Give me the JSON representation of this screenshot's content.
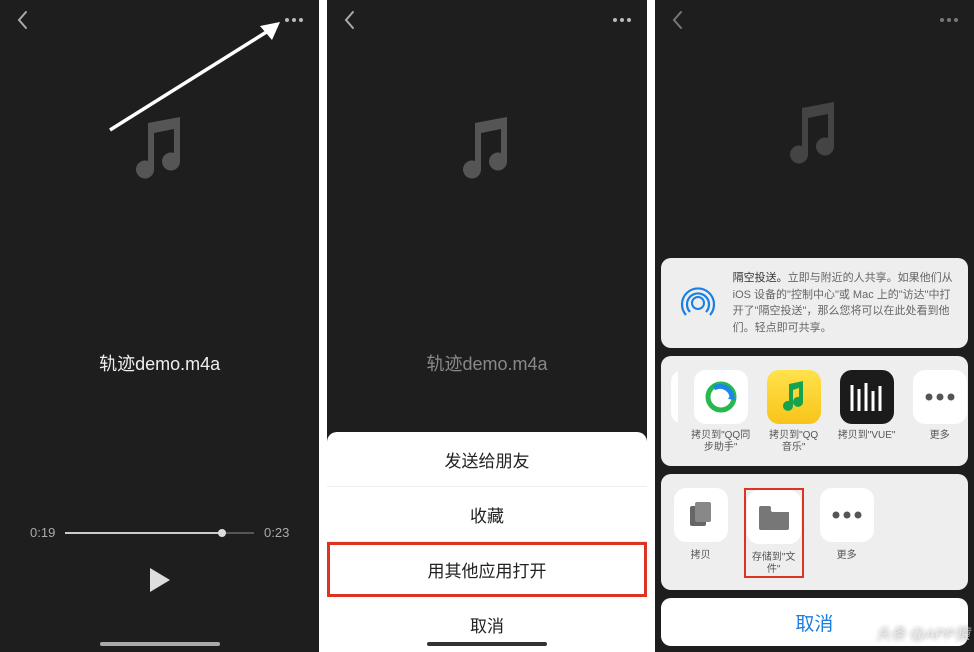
{
  "file": {
    "name": "轨迹demo.m4a"
  },
  "player": {
    "elapsed": "0:19",
    "duration": "0:23"
  },
  "screen2_sheet": {
    "options": [
      {
        "label": "发送给朋友",
        "highlight": false
      },
      {
        "label": "收藏",
        "highlight": false
      },
      {
        "label": "用其他应用打开",
        "highlight": true
      }
    ],
    "cancel": "取消"
  },
  "screen3_sheet": {
    "airdrop": {
      "title": "隔空投送。",
      "body": "立即与附近的人共享。如果他们从 iOS 设备的\"控制中心\"或 Mac 上的\"访达\"中打开了\"隔空投送\"，那么您将可以在此处看到他们。轻点即可共享。"
    },
    "apps": [
      {
        "label_line1": "",
        "label_line2": "",
        "bg": "#ffffff",
        "icon": "cut"
      },
      {
        "label_line1": "拷贝到\"QQ同",
        "label_line2": "步助手\"",
        "bg": "#ffffff",
        "icon": "qqsync"
      },
      {
        "label_line1": "拷贝到\"QQ",
        "label_line2": "音乐\"",
        "bg": "#fff",
        "icon": "qqmusic"
      },
      {
        "label_line1": "拷贝到\"VUE\"",
        "label_line2": "",
        "bg": "#1b1b1b",
        "icon": "vue"
      },
      {
        "label_line1": "更多",
        "label_line2": "",
        "bg": "#ffffff",
        "icon": "more"
      }
    ],
    "actions": [
      {
        "label": "拷贝",
        "icon": "copy",
        "highlight": false
      },
      {
        "label": "存储到\"文件\"",
        "icon": "folder",
        "highlight": true
      },
      {
        "label": "更多",
        "icon": "more",
        "highlight": false
      }
    ],
    "cancel": "取消"
  },
  "watermark": "头条 @APP猿"
}
